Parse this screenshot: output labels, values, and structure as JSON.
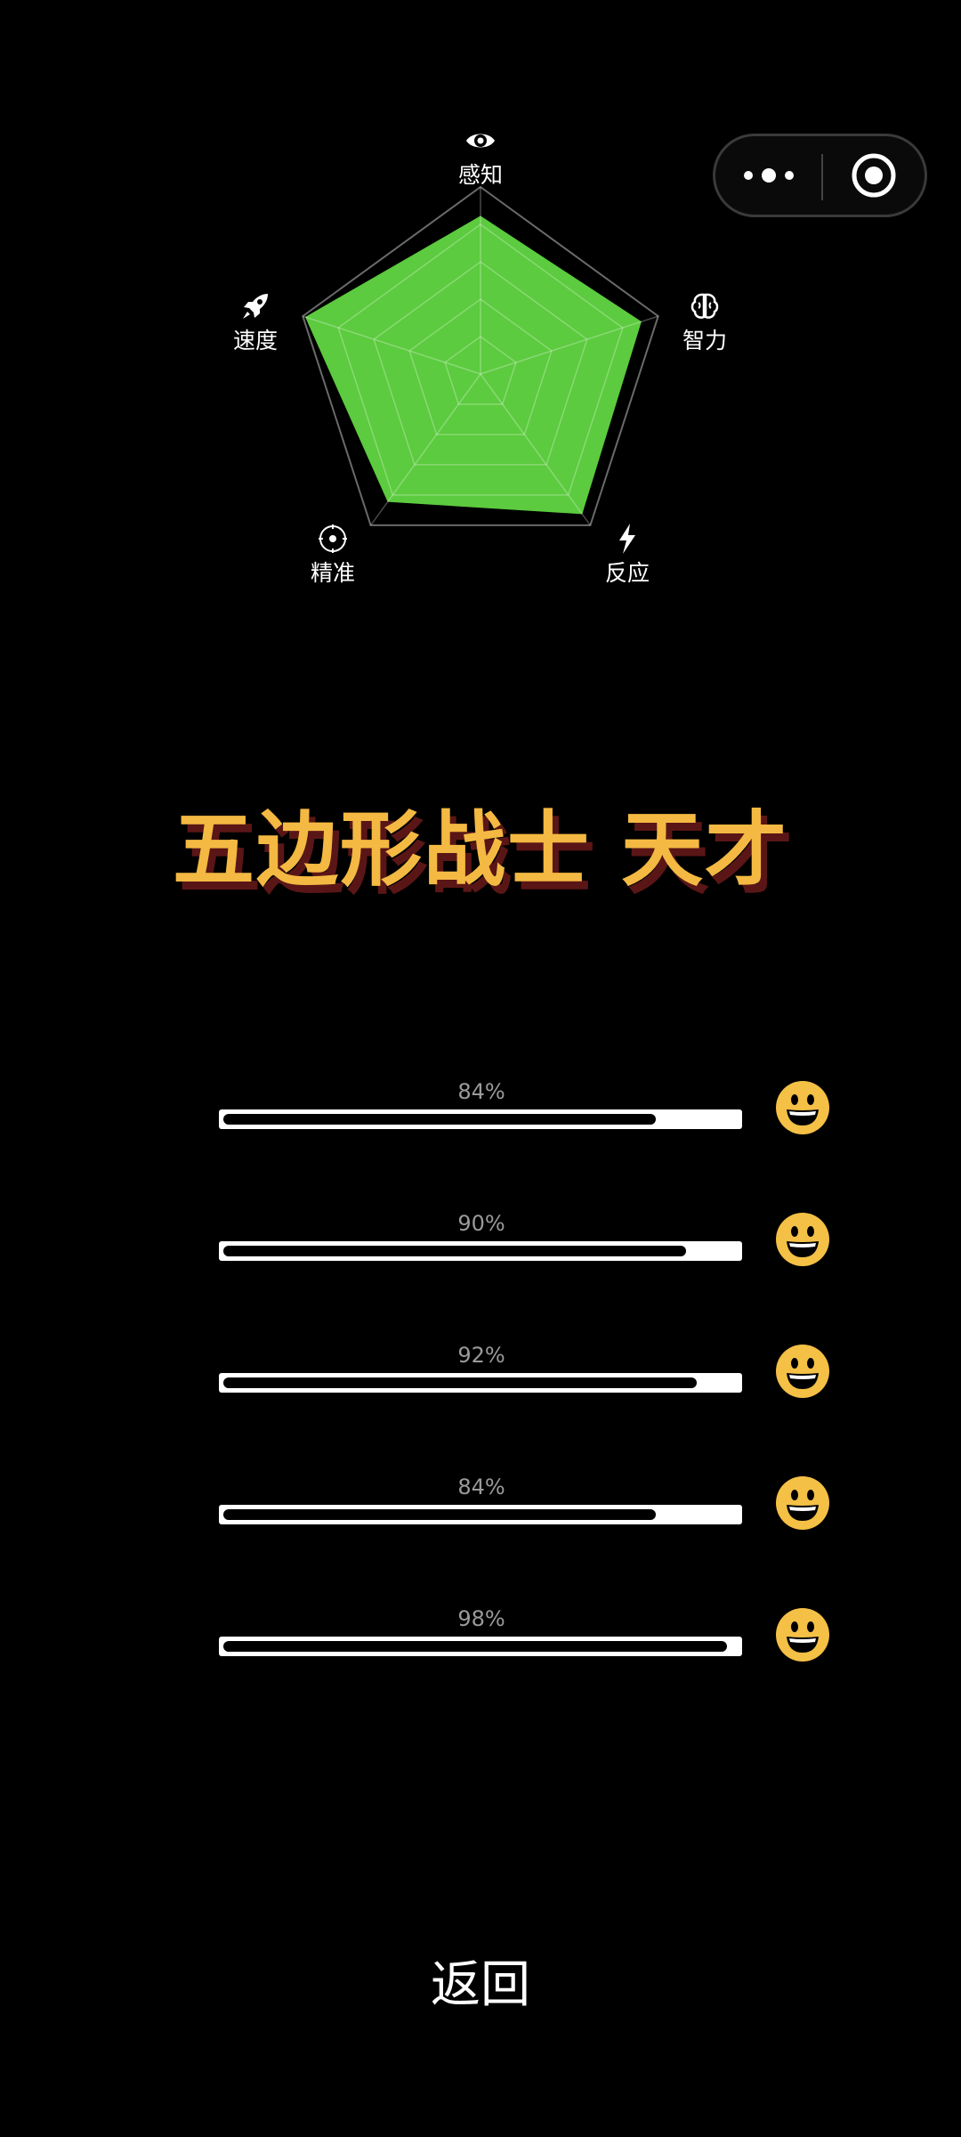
{
  "capsule": {
    "more_icon": "more-dots-icon",
    "close_icon": "target-close-icon"
  },
  "radar": {
    "labels": [
      "感知",
      "智力",
      "反应",
      "精准",
      "速度"
    ],
    "icons": [
      "eye-icon",
      "brain-icon",
      "lightning-icon",
      "target-icon",
      "rocket-icon"
    ],
    "values": [
      84,
      90,
      92,
      84,
      98
    ],
    "max": 100,
    "fill_color": "#5ccb3f",
    "grid_color": "#6a6a6a"
  },
  "title": "五边形战士 天才",
  "bars": [
    {
      "percent_label": "84%",
      "value": 84
    },
    {
      "percent_label": "90%",
      "value": 90
    },
    {
      "percent_label": "92%",
      "value": 92
    },
    {
      "percent_label": "84%",
      "value": 84
    },
    {
      "percent_label": "98%",
      "value": 98
    }
  ],
  "emoji_icon": "grinning-face-icon",
  "emoji_color": "#f4c045",
  "back_label": "返回"
}
